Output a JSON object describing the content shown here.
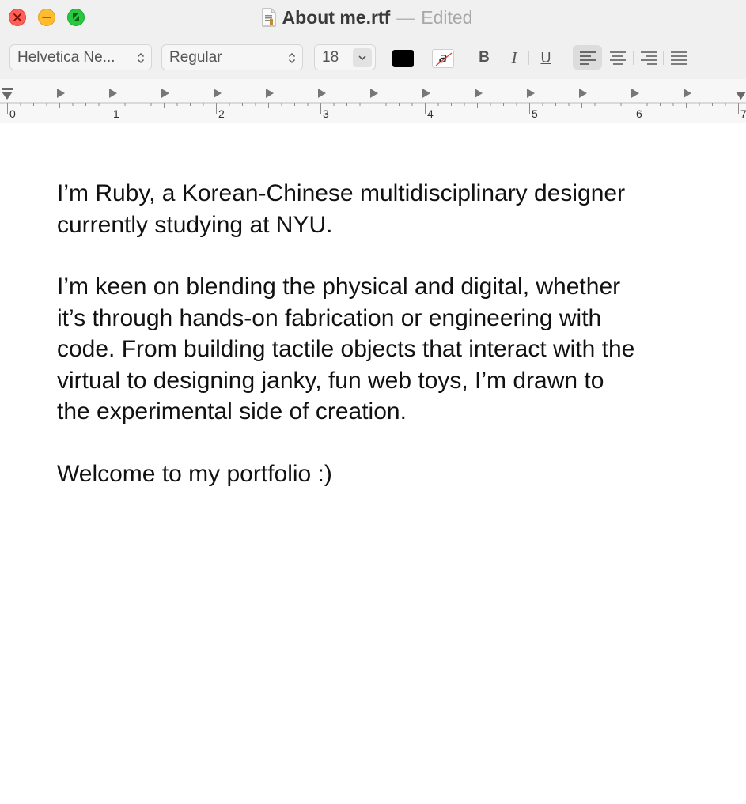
{
  "window": {
    "title": "About me.rtf",
    "separator": "—",
    "status": "Edited"
  },
  "toolbar": {
    "font_family": "Helvetica Ne...",
    "font_style": "Regular",
    "font_size": "18",
    "text_color": "#000000",
    "bg_color_glyph": "a",
    "bold_label": "B",
    "italic_label": "I",
    "underline_label": "U",
    "alignment": "left"
  },
  "ruler": {
    "labels": [
      "0",
      "1",
      "2",
      "3",
      "4",
      "5",
      "6",
      "7"
    ]
  },
  "document": {
    "paragraphs": [
      "I’m Ruby, a Korean-Chinese multidisciplinary designer\ncurrently studying at NYU.",
      "I’m keen on blending the physical and digital, whether\nit’s through hands-on fabrication or engineering with\ncode. From building tactile objects that interact with the\nvirtual to designing janky, fun web toys, I’m drawn to\nthe experimental side of creation.",
      "Welcome to my portfolio :)"
    ]
  },
  "colors": {
    "close": "#ff5f57",
    "minimize": "#febc2e",
    "zoom": "#28c840"
  },
  "icons": [
    "close-icon",
    "minimize-icon",
    "zoom-icon",
    "document-icon",
    "chevron-updown-icon",
    "chevron-down-icon",
    "align-left-icon",
    "align-center-icon",
    "align-right-icon",
    "align-justify-icon",
    "tab-stop-icon"
  ]
}
